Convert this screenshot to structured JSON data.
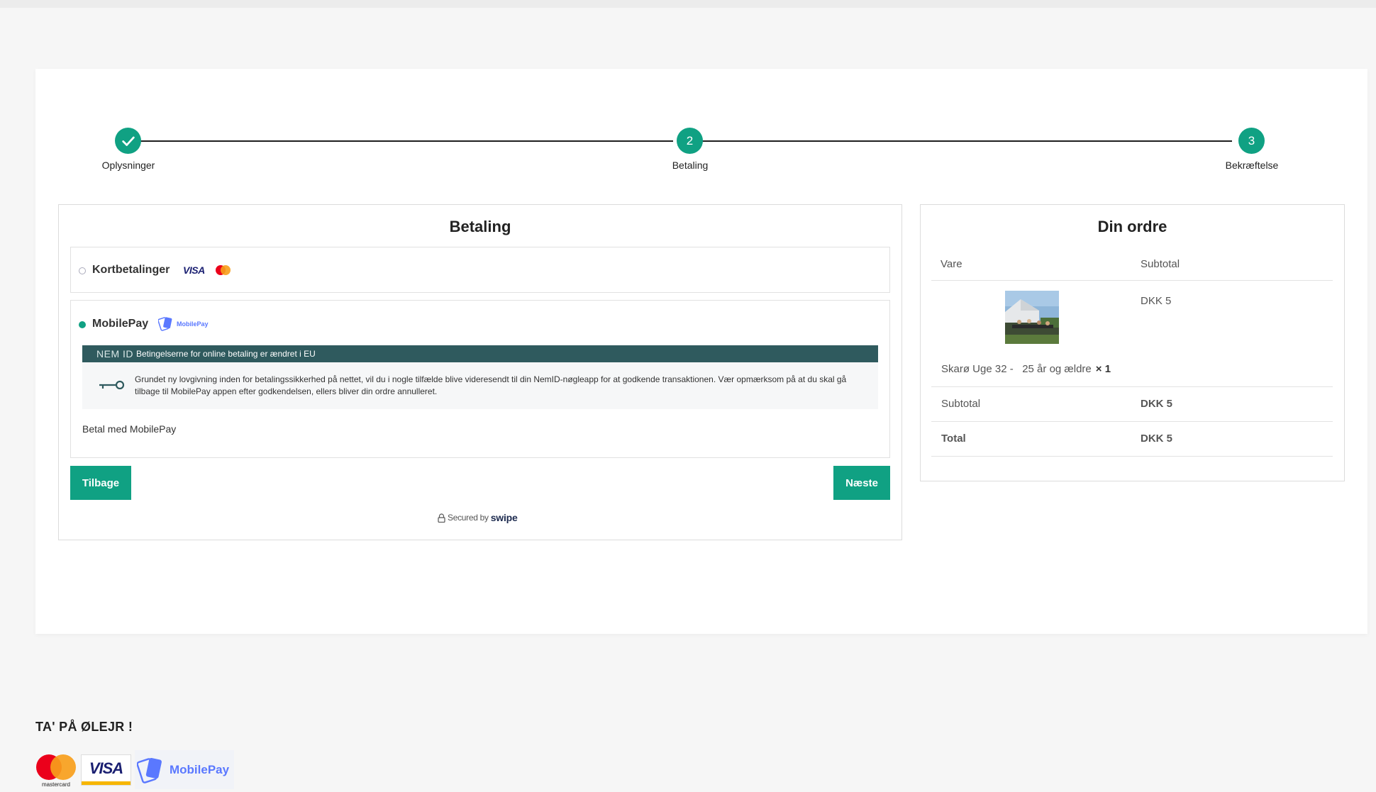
{
  "stepper": {
    "steps": [
      {
        "label": "Oplysninger",
        "number": "",
        "state": "done"
      },
      {
        "label": "Betaling",
        "number": "2",
        "state": "current"
      },
      {
        "label": "Bekræftelse",
        "number": "3",
        "state": "upcoming"
      }
    ]
  },
  "payment": {
    "title": "Betaling",
    "options": [
      {
        "label": "Kortbetalinger",
        "selected": false,
        "logos": [
          "visa-icon",
          "mastercard-icon"
        ],
        "visa_text": "VISA"
      },
      {
        "label": "MobilePay",
        "selected": true,
        "logo_text": "MobilePay"
      }
    ],
    "nemid": {
      "brand": "NEM ID",
      "headline": "Betingelserne for online betaling er ændret i EU",
      "body": "Grundet ny lovgivning inden for betalingssikkerhed på nettet, vil du i nogle tilfælde blive videresendt til din NemID-nøgleapp for at godkende transaktionen. Vær opmærksom på at du skal gå tilbage til MobilePay appen efter godkendelsen, ellers bliver din ordre annulleret."
    },
    "mobilepay_note": "Betal med MobilePay",
    "back_label": "Tilbage",
    "next_label": "Næste",
    "secured_prefix": "Secured by",
    "secured_brand": "swipe"
  },
  "order": {
    "title": "Din ordre",
    "col_item": "Vare",
    "col_subtotal": "Subtotal",
    "item": {
      "name": "Skarø Uge 32 -   25 år og ældre",
      "qty": "× 1",
      "price": "DKK 5"
    },
    "subtotal_label": "Subtotal",
    "subtotal_value": "DKK 5",
    "total_label": "Total",
    "total_value": "DKK 5"
  },
  "footer": {
    "title": "TA' PÅ ØLEJR !",
    "mastercard_text": "mastercard",
    "visa_text": "VISA",
    "mobilepay_text": "MobilePay"
  },
  "colors": {
    "accent": "#10a183",
    "nemid_bar": "#2f5a5e",
    "mobilepay_blue": "#5a78ff",
    "visa_blue": "#1a1f71"
  }
}
